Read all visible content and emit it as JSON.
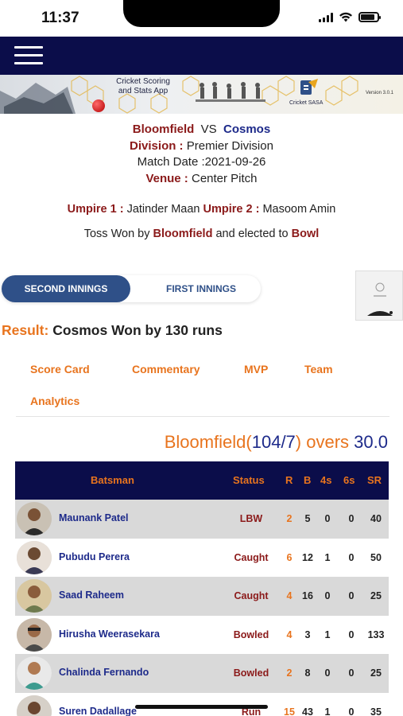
{
  "status_bar": {
    "time": "11:37"
  },
  "banner": {
    "title_line1": "Cricket Scoring",
    "title_line2": "and Stats App",
    "brand": "Cricket SASA",
    "version": "Version 3.0.1"
  },
  "match": {
    "team1": "Bloomfield",
    "vs": "VS",
    "team2": "Cosmos",
    "division_label": "Division :",
    "division_value": "Premier Division",
    "date_label": "Match Date :",
    "date_value": "2021-09-26",
    "venue_label": "Venue :",
    "venue_value": "Center Pitch",
    "umpire1_label": "Umpire 1 :",
    "umpire1_value": "Jatinder Maan",
    "umpire2_label": "Umpire 2 :",
    "umpire2_value": "Masoom Amin",
    "toss_prefix": "Toss Won by",
    "toss_team": "Bloomfield",
    "toss_middle": "and elected to",
    "toss_choice": "Bowl"
  },
  "innings_tabs": {
    "second": "SECOND INNINGS",
    "first": "FIRST INNINGS",
    "active": "second"
  },
  "result": {
    "label": "Result:",
    "text": "Cosmos Won by 130 runs"
  },
  "menu": {
    "score_card": "Score Card",
    "commentary": "Commentary",
    "mvp": "MVP",
    "team": "Team",
    "analytics": "Analytics"
  },
  "score": {
    "team": "Bloomfield",
    "open": "(",
    "runs": "104/7",
    "close": ")",
    "overs_label": "overs",
    "overs_value": "30.0"
  },
  "batting": {
    "headers": {
      "batsman": "Batsman",
      "status": "Status",
      "r": "R",
      "b": "B",
      "fours": "4s",
      "sixes": "6s",
      "sr": "SR"
    },
    "rows": [
      {
        "name": "Maunank Patel",
        "status": "LBW",
        "r": "2",
        "b": "5",
        "fours": "0",
        "sixes": "0",
        "sr": "40"
      },
      {
        "name": "Pubudu Perera",
        "status": "Caught",
        "r": "6",
        "b": "12",
        "fours": "1",
        "sixes": "0",
        "sr": "50"
      },
      {
        "name": "Saad Raheem",
        "status": "Caught",
        "r": "4",
        "b": "16",
        "fours": "0",
        "sixes": "0",
        "sr": "25"
      },
      {
        "name": "Hirusha Weerasekara",
        "status": "Bowled",
        "r": "4",
        "b": "3",
        "fours": "1",
        "sixes": "0",
        "sr": "133"
      },
      {
        "name": "Chalinda Fernando",
        "status": "Bowled",
        "r": "2",
        "b": "8",
        "fours": "0",
        "sixes": "0",
        "sr": "25"
      },
      {
        "name": "Suren Dadallage",
        "status": "Run out",
        "r": "15",
        "b": "43",
        "fours": "1",
        "sixes": "0",
        "sr": "35"
      }
    ]
  },
  "colors": {
    "navy": "#0b0d4a",
    "orange": "#e8741e",
    "maroon": "#8b1a1a",
    "blue": "#1d2a8a",
    "tab_active": "#2f5088"
  },
  "icons": {
    "menu": "hamburger-icon",
    "ball": "cricket-ball-icon"
  }
}
